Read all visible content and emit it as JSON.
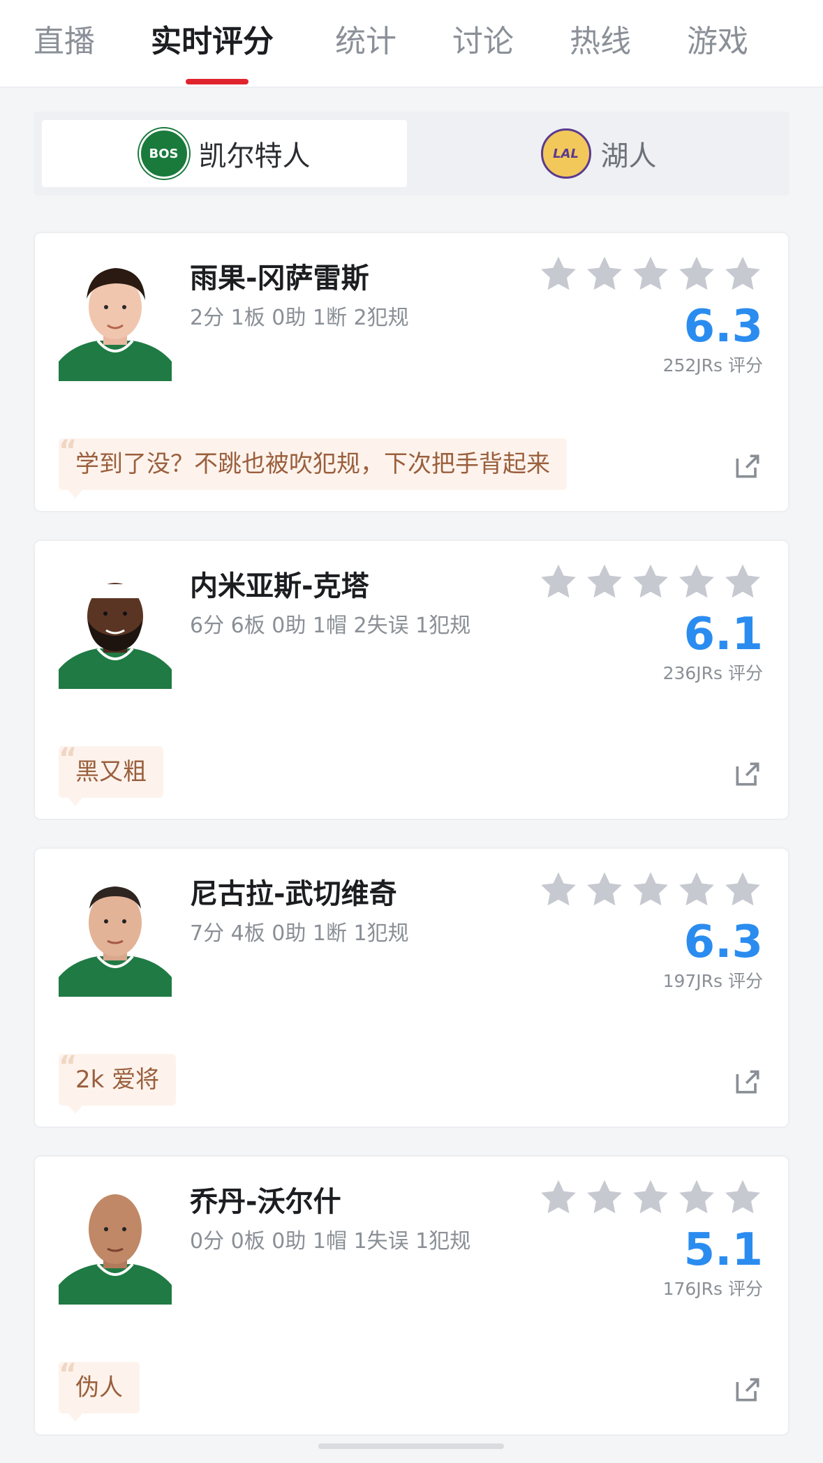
{
  "tabs": [
    {
      "label": "直播",
      "active": false
    },
    {
      "label": "实时评分",
      "active": true
    },
    {
      "label": "统计",
      "active": false
    },
    {
      "label": "讨论",
      "active": false
    },
    {
      "label": "热线",
      "active": false
    },
    {
      "label": "游戏",
      "active": false
    }
  ],
  "teams": {
    "home": {
      "name": "凯尔特人",
      "logo_text": "BOS",
      "logo_icon": "celtics-logo-icon",
      "selected": true
    },
    "away": {
      "name": "湖人",
      "logo_text": "LAL",
      "logo_icon": "lakers-logo-icon",
      "selected": false
    }
  },
  "players": [
    {
      "name": "雨果-冈萨雷斯",
      "stats": "2分 1板 0助 1断 2犯规",
      "score": "6.3",
      "votes": "252JRs 评分",
      "comment": "学到了没？不跳也被吹犯规，下次把手背起来",
      "stars": 5
    },
    {
      "name": "内米亚斯-克塔",
      "stats": "6分 6板 0助 1帽 2失误 1犯规",
      "score": "6.1",
      "votes": "236JRs 评分",
      "comment": "黑又粗",
      "stars": 5
    },
    {
      "name": "尼古拉-武切维奇",
      "stats": "7分 4板 0助 1断 1犯规",
      "score": "6.3",
      "votes": "197JRs 评分",
      "comment": "2k 爱将",
      "stars": 5
    },
    {
      "name": "乔丹-沃尔什",
      "stats": "0分 0板 0助 1帽 1失误 1犯规",
      "score": "5.1",
      "votes": "176JRs 评分",
      "comment": "伪人",
      "stars": 5
    }
  ],
  "colors": {
    "accent_red": "#e0242f",
    "score_blue": "#2b8cf0",
    "star_gray": "#c7c9d1",
    "quote_bg": "#fdf3ec",
    "quote_text": "#9a5f3d",
    "jersey_green": "#1f7a44"
  }
}
